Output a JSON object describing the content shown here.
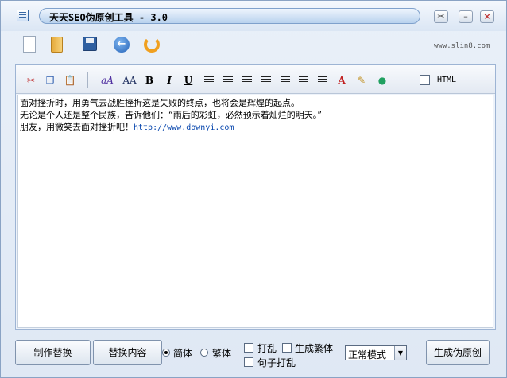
{
  "window": {
    "title": "天天SEO伪原创工具 - 3.0",
    "site_url": "www.slin8.com"
  },
  "toolbar": {
    "icons": [
      "new-document-icon",
      "open-folder-icon",
      "save-icon",
      "back-icon",
      "redo-icon"
    ]
  },
  "editor_toolbar": {
    "bold": "B",
    "italic": "I",
    "underline": "U",
    "html_label": "HTML",
    "html_checked": false
  },
  "editor": {
    "lines": [
      "面对挫折时，用勇气去战胜挫折这是失败的终点，也将会是辉煌的起点。",
      "无论是个人还是整个民族，告诉他们：“雨后的彩虹，必然预示着灿烂的明天。”",
      "朋友，用微笑去面对挫折吧！"
    ],
    "link": "http://www.downyi.com"
  },
  "bottom": {
    "make_button": "制作替换",
    "replace_button": "替换内容",
    "simplified_label": "简体",
    "traditional_label": "繁体",
    "simplified_selected": true,
    "shuffle_label": "打乱",
    "gen_traditional_label": "生成繁体",
    "sentence_shuffle_label": "句子打乱",
    "mode_value": "正常模式",
    "generate_button": "生成伪原创"
  }
}
